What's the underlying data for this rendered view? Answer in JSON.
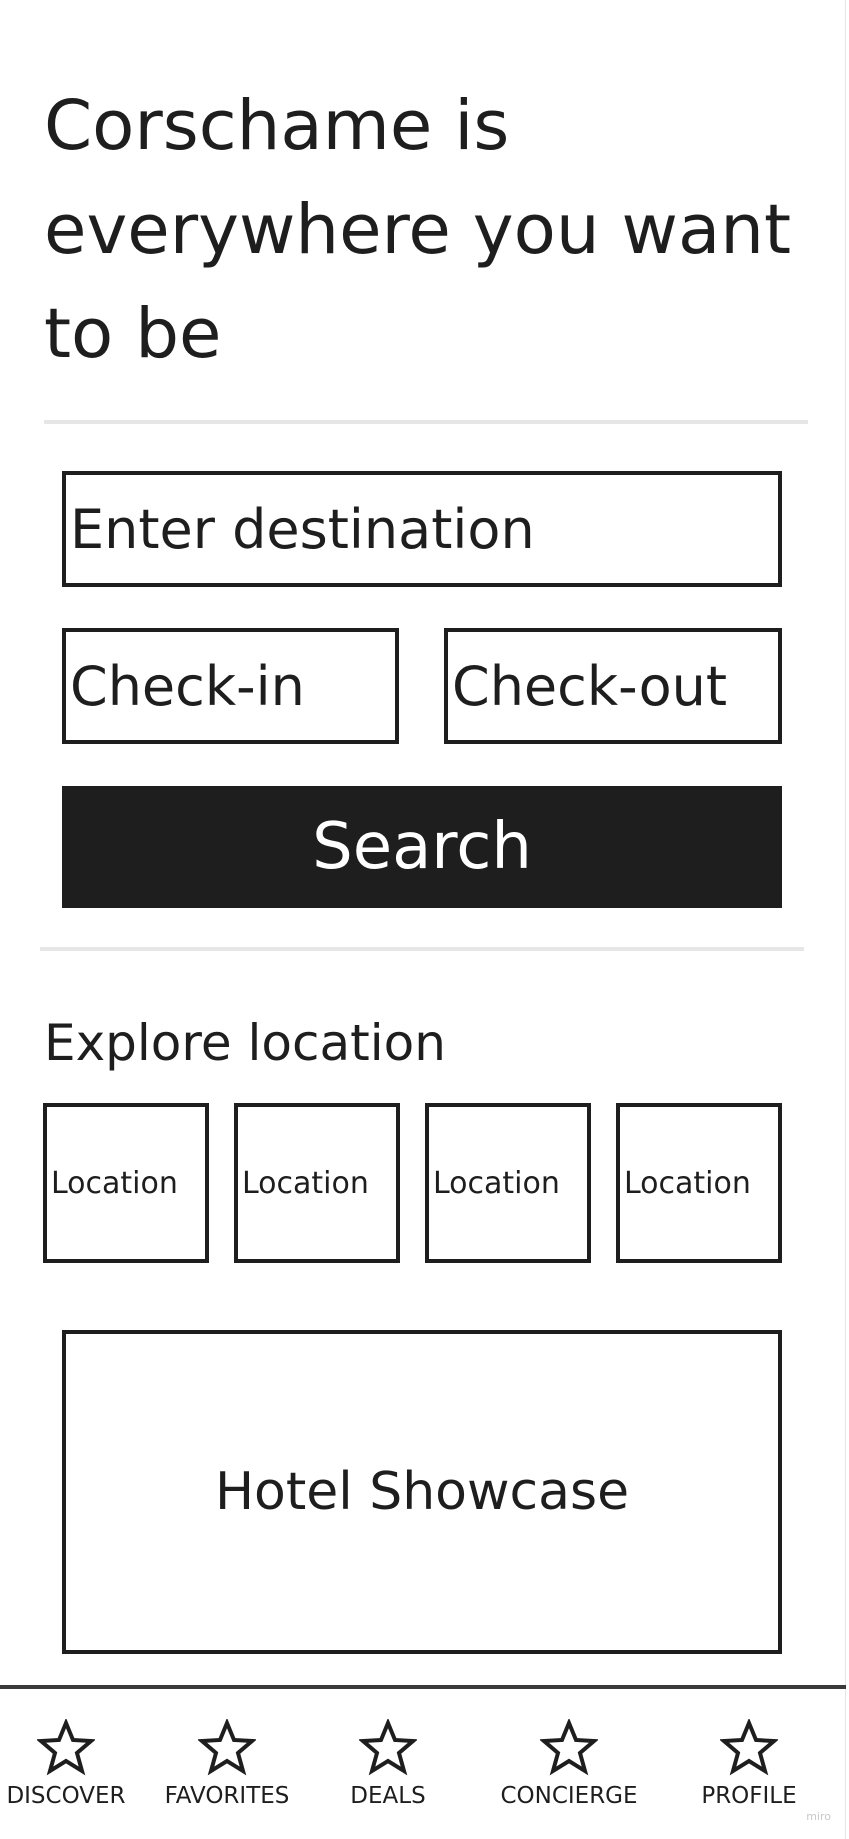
{
  "hero": {
    "title": "Corschame is everywhere you want to be"
  },
  "search": {
    "destination_placeholder": "Enter destination",
    "checkin_placeholder": "Check-in",
    "checkout_placeholder": "Check-out",
    "button_label": "Search"
  },
  "explore": {
    "title": "Explore location",
    "locations": [
      {
        "label": "Location"
      },
      {
        "label": "Location"
      },
      {
        "label": "Location"
      },
      {
        "label": "Location"
      }
    ]
  },
  "showcase": {
    "label": "Hotel Showcase"
  },
  "bottom_nav": {
    "items": [
      {
        "label": "DISCOVER",
        "icon": "star-icon"
      },
      {
        "label": "FAVORITES",
        "icon": "star-icon"
      },
      {
        "label": "DEALS",
        "icon": "star-icon"
      },
      {
        "label": "CONCIERGE",
        "icon": "star-icon"
      },
      {
        "label": "PROFILE",
        "icon": "star-icon"
      }
    ]
  },
  "watermark": "miro"
}
